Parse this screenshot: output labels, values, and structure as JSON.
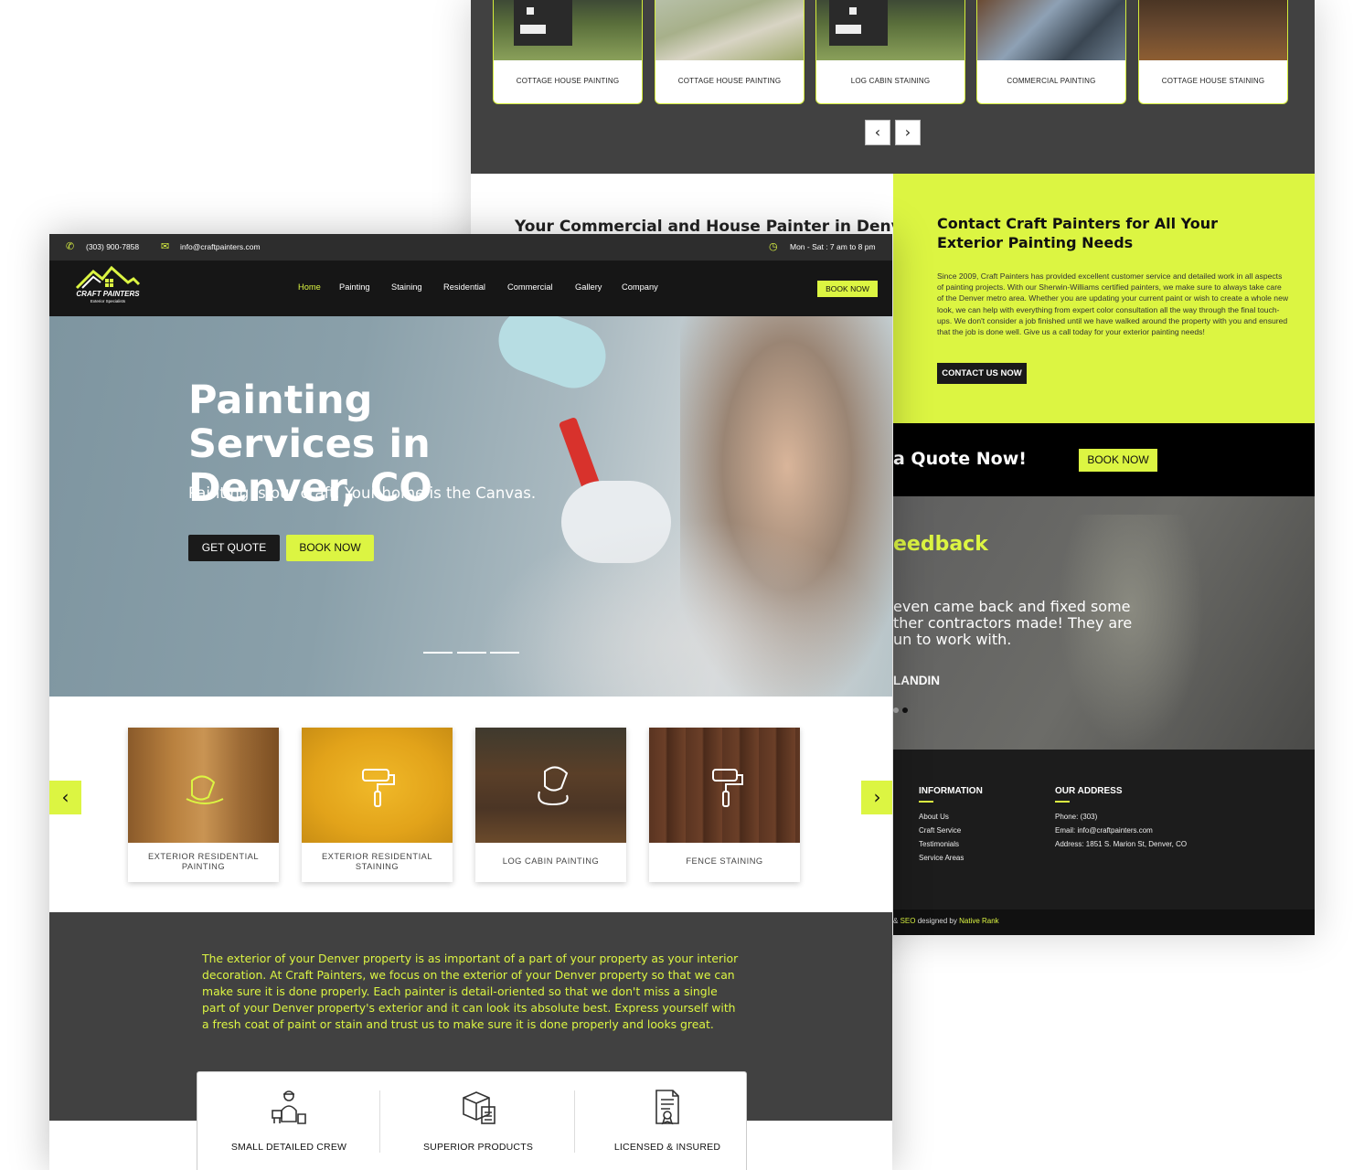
{
  "back_page": {
    "gallery": {
      "cards": [
        {
          "label": "COTTAGE HOUSE PAINTING"
        },
        {
          "label": "COTTAGE HOUSE PAINTING"
        },
        {
          "label": "LOG CABIN STAINING"
        },
        {
          "label": "COMMERCIAL PAINTING"
        },
        {
          "label": "COTTAGE HOUSE STAINING"
        }
      ]
    },
    "intro_heading": "Your Commercial and House Painter in Denver",
    "contact": {
      "heading": "Contact Craft Painters for All Your Exterior Painting Needs",
      "body": "Since 2009, Craft Painters has provided excellent customer service and detailed work in all aspects of painting projects. With our Sherwin-Williams certified painters, we make sure to always take care of the Denver metro area. Whether you are updating your current paint or wish to create a whole new look, we can help with everything from expert color consultation all the way through the final touch-ups. We don't consider a job finished until we have walked around the property with you and ensured that the job is done well. Give us a call today for your exterior painting needs!",
      "button": "CONTACT US NOW"
    },
    "quote_strip": {
      "text": "a Quote Now!",
      "button": "BOOK NOW"
    },
    "testimonial": {
      "heading": "eedback",
      "quote": "even came back and fixed some ther contractors made! They are un to work with.",
      "name": "LANDIN"
    },
    "footer": {
      "information_heading": "INFORMATION",
      "information_links": [
        "About Us",
        "Craft Service",
        "Testimonials",
        "Service Areas"
      ],
      "address_heading": "OUR ADDRESS",
      "phone": "Phone: (303)",
      "email": "Email: info@craftpainters.com",
      "address": "Address: 1851 S. Marion St, Denver, CO",
      "copyright_prefix": "&",
      "copyright_seo": "SEO",
      "copyright_mid": "designed by",
      "copyright_by": "Native Rank"
    }
  },
  "front_page": {
    "topbar": {
      "phone": "(303) 900-7858",
      "email": "info@craftpainters.com",
      "hours": "Mon - Sat : 7 am to 8 pm"
    },
    "logo": {
      "name": "CRAFT PAINTERS",
      "tagline": "Exterior Specialists"
    },
    "nav": {
      "items": [
        "Home",
        "Painting",
        "Staining",
        "Residential",
        "Commercial",
        "Gallery",
        "Company"
      ],
      "book_button": "BOOK NOW"
    },
    "hero": {
      "title": "Painting Services in Denver, CO",
      "subtitle": "Painting is our craft. Your home is the Canvas.",
      "quote_button": "GET QUOTE",
      "book_button": "BOOK NOW"
    },
    "services": [
      {
        "label": "EXTERIOR RESIDENTIAL PAINTING"
      },
      {
        "label": "EXTERIOR RESIDENTIAL STAINING"
      },
      {
        "label": "LOG CABIN PAINTING"
      },
      {
        "label": "FENCE STAINING"
      }
    ],
    "about_text": "The exterior of your Denver property is as important of a part of your property as your interior decoration. At Craft Painters, we focus on the exterior of your Denver property so that we can make sure it is done properly. Each painter is detail-oriented so that we don't miss a single part of your Denver property's exterior and it can look its absolute best. Express yourself with a fresh coat of paint or stain and trust us to make sure it is done properly and looks great.",
    "features": [
      {
        "label": "SMALL DETAILED CREW",
        "icon": "crew-icon"
      },
      {
        "label": "SUPERIOR PRODUCTS",
        "icon": "products-icon"
      },
      {
        "label": "LICENSED & INSURED",
        "icon": "certificate-icon"
      }
    ]
  },
  "colors": {
    "accent": "#dcf542",
    "dark": "#414141",
    "nav": "#161616",
    "black": "#000000"
  }
}
